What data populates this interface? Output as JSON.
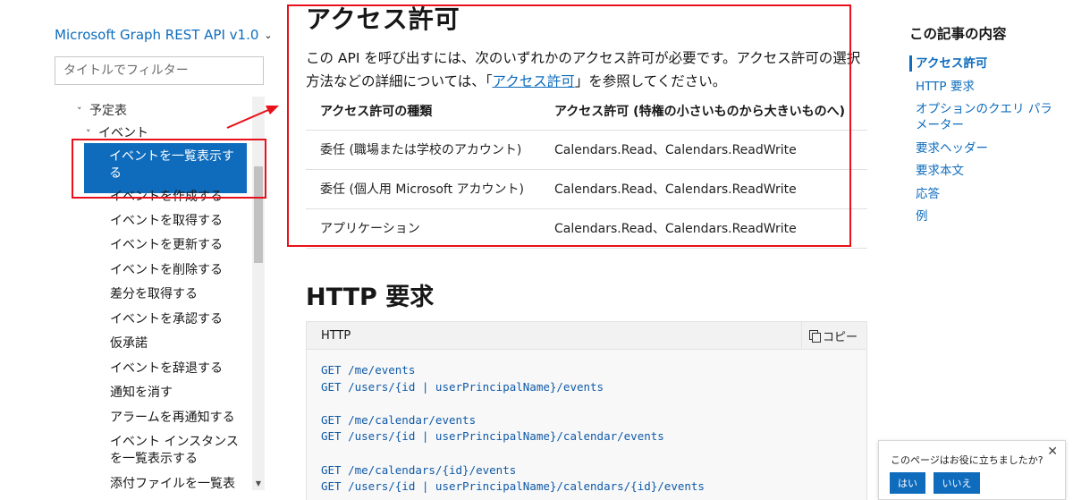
{
  "sidebar": {
    "product_title": "Microsoft Graph REST API v1.0",
    "filter_placeholder": "タイトルでフィルター",
    "cut_row": "予定表",
    "group": "イベント",
    "active_item": "イベントを一覧表示する",
    "items": [
      "イベントを作成する",
      "イベントを取得する",
      "イベントを更新する",
      "イベントを削除する",
      "差分を取得する",
      "イベントを承認する",
      "仮承諾",
      "イベントを辞退する",
      "通知を消す",
      "アラームを再通知する",
      "イベント インスタンスを一覧表示する",
      "添付ファイルを一覧表"
    ]
  },
  "main": {
    "permissions_heading": "アクセス許可",
    "intro_before": "この API を呼び出すには、次のいずれかのアクセス許可が必要です。アクセス許可の選択方法などの詳細については、「",
    "intro_link": "アクセス許可",
    "intro_after": "」を参照してください。",
    "table": {
      "headers": [
        "アクセス許可の種類",
        "アクセス許可 (特権の小さいものから大きいものへ)"
      ],
      "rows": [
        [
          "委任 (職場または学校のアカウント)",
          "Calendars.Read、Calendars.ReadWrite"
        ],
        [
          "委任 (個人用 Microsoft アカウント)",
          "Calendars.Read、Calendars.ReadWrite"
        ],
        [
          "アプリケーション",
          "Calendars.Read、Calendars.ReadWrite"
        ]
      ]
    },
    "http_heading": "HTTP 要求",
    "code_lang": "HTTP",
    "copy_label": "コピー",
    "code": "GET /me/events\nGET /users/{id | userPrincipalName}/events\n\nGET /me/calendar/events\nGET /users/{id | userPrincipalName}/calendar/events\n\nGET /me/calendars/{id}/events\nGET /users/{id | userPrincipalName}/calendars/{id}/events"
  },
  "toc": {
    "title": "この記事の内容",
    "items": [
      "アクセス許可",
      "HTTP 要求",
      "オプションのクエリ パラメーター",
      "要求ヘッダー",
      "要求本文",
      "応答",
      "例"
    ]
  },
  "feedback": {
    "question": "このページはお役に立ちましたか?",
    "yes": "はい",
    "no": "いいえ",
    "close": "✕"
  },
  "colors": {
    "accent": "#0f6cbd",
    "annotation": "#e8111b"
  }
}
